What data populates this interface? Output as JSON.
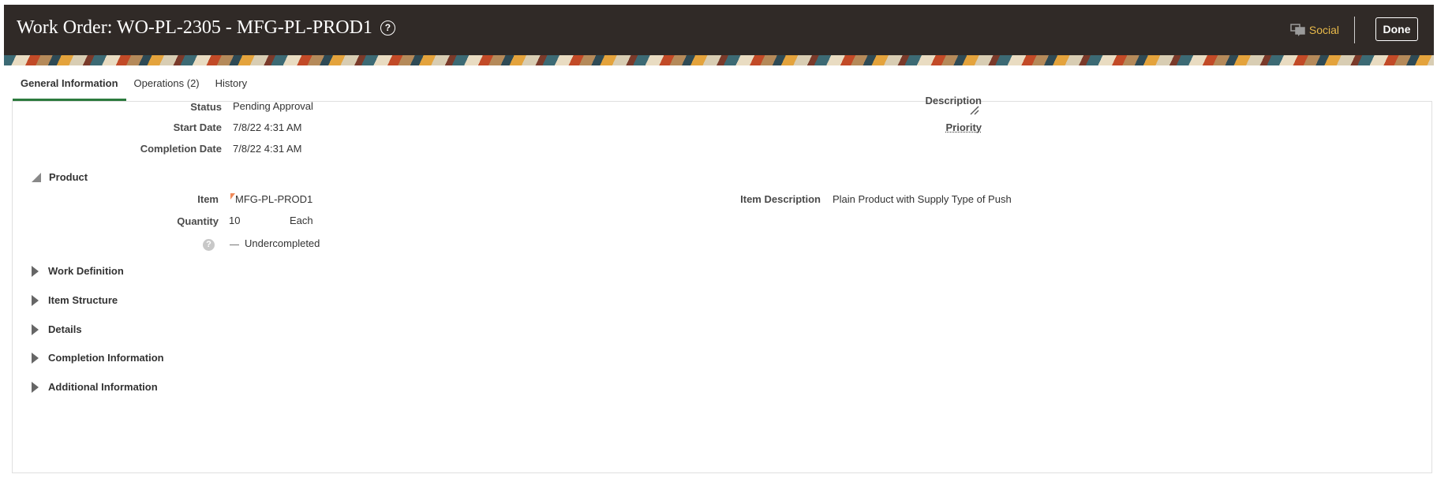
{
  "header": {
    "title": "Work Order: WO-PL-2305 - MFG-PL-PROD1",
    "help_icon_label": "?",
    "social_label": "Social",
    "done_label": "Done"
  },
  "tabs": [
    {
      "label": "General Information",
      "active": true
    },
    {
      "label": "Operations (2)",
      "active": false
    },
    {
      "label": "History",
      "active": false
    }
  ],
  "general": {
    "status_label": "Status",
    "status_value": "Pending Approval",
    "start_date_label": "Start Date",
    "start_date_value": "7/8/22 4:31 AM",
    "completion_date_label": "Completion Date",
    "completion_date_value": "7/8/22 4:31 AM",
    "description_label": "Description",
    "priority_label": "Priority"
  },
  "product": {
    "section_label": "Product",
    "item_label": "Item",
    "item_value": "MFG-PL-PROD1",
    "quantity_label": "Quantity",
    "quantity_value": "10",
    "uom_value": "Each",
    "help_icon_label": "?",
    "undercompleted_value": "Undercompleted",
    "item_description_label": "Item Description",
    "item_description_value": "Plain Product with Supply Type of Push"
  },
  "sections": [
    "Work Definition",
    "Item Structure",
    "Details",
    "Completion Information",
    "Additional Information"
  ],
  "colors": {
    "header_bg": "#302a27",
    "social_accent": "#e8b94a",
    "active_tab_underline": "#2b7a3d",
    "item_flag": "#f08a5a"
  }
}
